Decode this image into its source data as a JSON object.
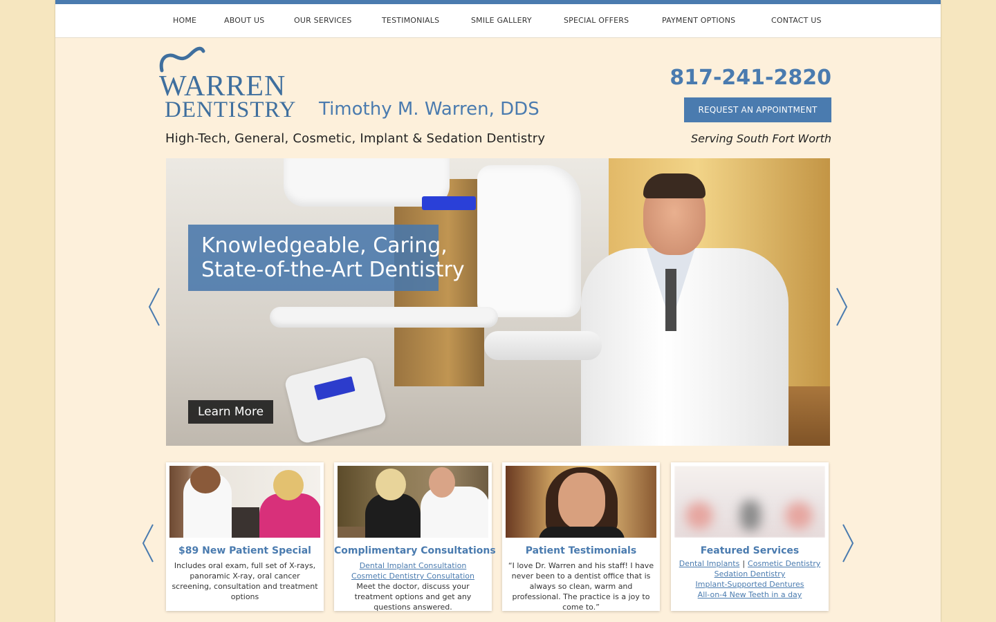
{
  "nav": {
    "items": [
      "HOME",
      "ABOUT US",
      "OUR SERVICES",
      "TESTIMONIALS",
      "SMILE GALLERY",
      "SPECIAL OFFERS",
      "PAYMENT OPTIONS",
      "CONTACT US"
    ]
  },
  "header": {
    "logo_line1": "WARREN",
    "logo_line2": "DENTISTRY",
    "doctor_name": "Timothy M. Warren, DDS",
    "tagline": "High-Tech, General, Cosmetic, Implant & Sedation Dentistry",
    "phone": "817-241-2820",
    "request_button": "REQUEST AN APPOINTMENT",
    "serving": "Serving South Fort Worth"
  },
  "hero": {
    "caption_line1": "Knowledgeable, Caring,",
    "caption_line2": "State-of-the-Art Dentistry",
    "learn_more": "Learn More",
    "arrow_prev": "previous-slide",
    "arrow_next": "next-slide"
  },
  "cards": [
    {
      "title": "$89 New Patient Special",
      "body": "Includes oral exam, full set of X-rays, panoramic X-ray, oral cancer screening, consultation and treatment options"
    },
    {
      "title": "Complimentary Consultations",
      "link1": "Dental Implant Consultation",
      "link2": "Cosmetic Dentistry Consultation",
      "body": "Meet the doctor, discuss your treatment options and get any questions answered."
    },
    {
      "title": "Patient Testimonials",
      "body": "“I love Dr. Warren and his staff! I have never been to a dentist office that is always so clean, warm and professional. The practice is a joy to come to.”"
    },
    {
      "title": "Featured Services",
      "link1": "Dental Implants",
      "separator": "|",
      "link2": "Cosmetic Dentistry",
      "link3": "Sedation Dentistry",
      "link4": "Implant-Supported Dentures",
      "link5": "All-on-4 New Teeth in a day"
    }
  ],
  "colors": {
    "accent": "#4a7baf",
    "background": "#f6e6bf",
    "panel": "#fdf0db"
  }
}
